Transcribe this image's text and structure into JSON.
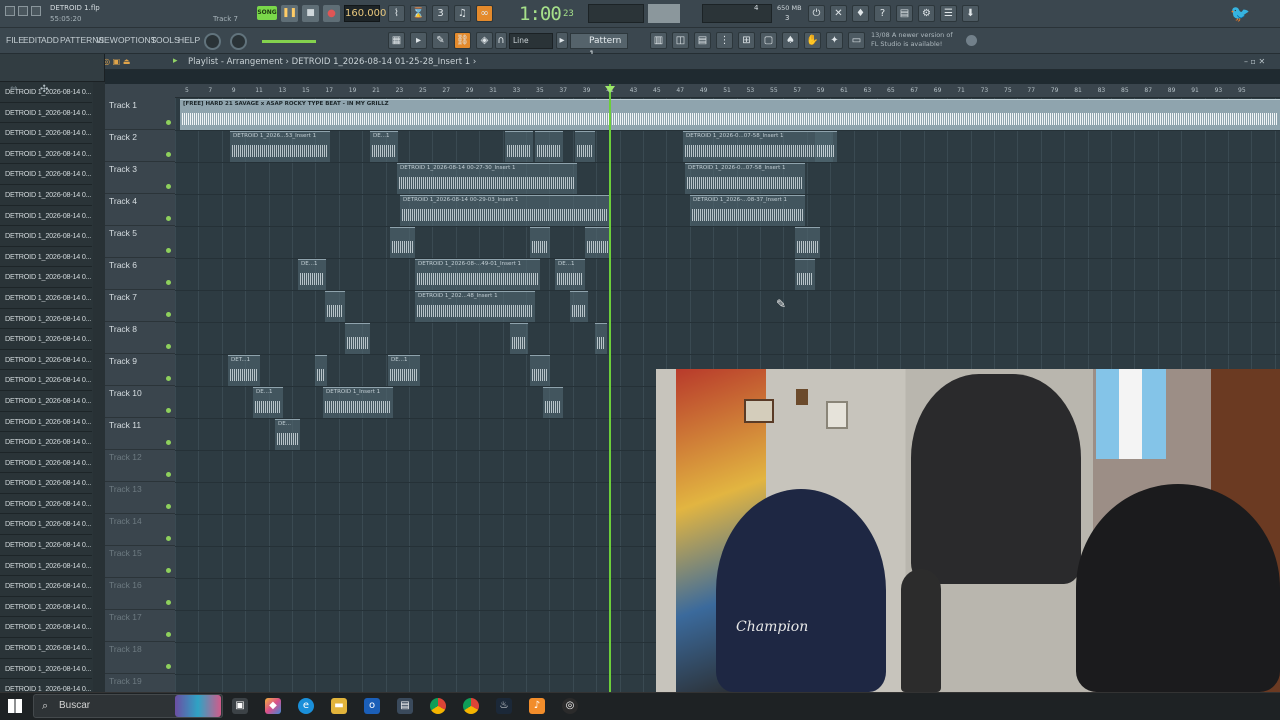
{
  "window": {
    "title": "DETROID 1.flp",
    "time_elapsed": "55:05:20",
    "active_track": "Track 7"
  },
  "transport": {
    "song_label": "SONG",
    "tempo": "160.000",
    "time_display": "1:00",
    "time_ticks": "23",
    "memory": "650 MB",
    "cpu_label": "4",
    "poly_label": "3"
  },
  "menu": [
    "FILE",
    "EDIT",
    "ADD",
    "PATTERNS",
    "VIEW",
    "OPTIONS",
    "TOOLS",
    "HELP"
  ],
  "snap": {
    "value": "Line"
  },
  "pattern": {
    "label": "Pattern 1"
  },
  "news": {
    "date": "13/08",
    "line1": "A newer version of",
    "line2": "FL Studio is available!"
  },
  "playlist": {
    "title": "Playlist - Arrangement",
    "breadcrumb": "DETROID 1_2026-08-14 01-25-28_Insert 1"
  },
  "browser": {
    "items": [
      "DETROID 1_2026-08-14 0...",
      "DETROID 1_2026-08-14 0...",
      "DETROID 1_2026-08-14 0...",
      "DETROID 1_2026-08-14 0...",
      "DETROID 1_2026-08-14 0...",
      "DETROID 1_2026-08-14 0...",
      "DETROID 1_2026-08-14 0...",
      "DETROID 1_2026-08-14 0...",
      "DETROID 1_2026-08-14 0...",
      "DETROID 1_2026-08-14 0...",
      "DETROID 1_2026-08-14 0...",
      "DETROID 1_2026-08-14 0...",
      "DETROID 1_2026-08-14 0...",
      "DETROID 1_2026-08-14 0...",
      "DETROID 1_2026-08-14 0...",
      "DETROID 1_2026-08-14 0...",
      "DETROID 1_2026-08-14 0...",
      "DETROID 1_2026-08-14 0...",
      "DETROID 1_2026-08-14 0...",
      "DETROID 1_2026-08-14 0...",
      "DETROID 1_2026-08-14 0...",
      "DETROID 1_2026-08-14 0...",
      "DETROID 1_2026-08-14 0...",
      "DETROID 1_2026-08-14 0...",
      "DETROID 1_2026-08-14 0...",
      "DETROID 1_2026-08-14 0...",
      "DETROID 1_2026-08-14 0...",
      "DETROID 1_2026-08-14 0...",
      "DETROID 1_2026-08-14 0...",
      "DETROID 1_2026-08-14 0..."
    ]
  },
  "tracks": [
    {
      "name": "Track 1",
      "active": true
    },
    {
      "name": "Track 2",
      "active": true
    },
    {
      "name": "Track 3",
      "active": true
    },
    {
      "name": "Track 4",
      "active": true
    },
    {
      "name": "Track 5",
      "active": true
    },
    {
      "name": "Track 6",
      "active": true
    },
    {
      "name": "Track 7",
      "active": true
    },
    {
      "name": "Track 8",
      "active": true
    },
    {
      "name": "Track 9",
      "active": true
    },
    {
      "name": "Track 10",
      "active": true
    },
    {
      "name": "Track 11",
      "active": true
    },
    {
      "name": "Track 12",
      "active": false
    },
    {
      "name": "Track 13",
      "active": false
    },
    {
      "name": "Track 14",
      "active": false
    },
    {
      "name": "Track 15",
      "active": false
    },
    {
      "name": "Track 16",
      "active": false
    },
    {
      "name": "Track 17",
      "active": false
    },
    {
      "name": "Track 18",
      "active": false
    },
    {
      "name": "Track 19",
      "active": false
    }
  ],
  "ruler": [
    "5",
    "7",
    "9",
    "11",
    "13",
    "15",
    "17",
    "19",
    "21",
    "23",
    "25",
    "27",
    "29",
    "31",
    "33",
    "35",
    "37",
    "39",
    "41",
    "43",
    "45",
    "47",
    "49",
    "51",
    "53",
    "55",
    "57",
    "59",
    "61",
    "63",
    "65",
    "67",
    "69",
    "71",
    "73",
    "75",
    "77",
    "79",
    "81",
    "83",
    "85",
    "87",
    "89",
    "91",
    "93",
    "95"
  ],
  "clips": {
    "main": "[FREE] HARD 21 SAVAGE x ASAP ROCKY TYPE BEAT - IN MY GRILLZ",
    "t2a": "DETROID 1_2026...53_Insert 1",
    "t2b": "DE...1",
    "t2c": "DETROID 1_2026-0...07-58_Insert 1",
    "t3a": "DETROID 1_2026-08-14 00-27-30_Insert 1",
    "t3b": "DETROID 1_2026-0...07-58_Insert 1",
    "t4a": "DETROID 1_2026-08-14 00-29-03_Insert 1",
    "t4b": "DETROID 1_2026-...08-37_Insert 1",
    "t6a": "DE...1",
    "t6b": "DETROID 1_2026-08-...49-01_Insert 1",
    "t6c": "DE...1",
    "t7a": "DETROID 1_202...48_Insert 1",
    "t9a": "DET...1",
    "t9b": "DE...1",
    "t10a": "DE...1",
    "t10b": "DETROID 1_Insert 1",
    "t11a": "DE..."
  },
  "webcam": {
    "shirt_text": "Champion"
  },
  "taskbar": {
    "search_placeholder": "Buscar"
  },
  "colors": {
    "accent_green": "#6ccf3a",
    "tempo_text": "#e9c87d",
    "clock_green": "#a6e08a"
  }
}
